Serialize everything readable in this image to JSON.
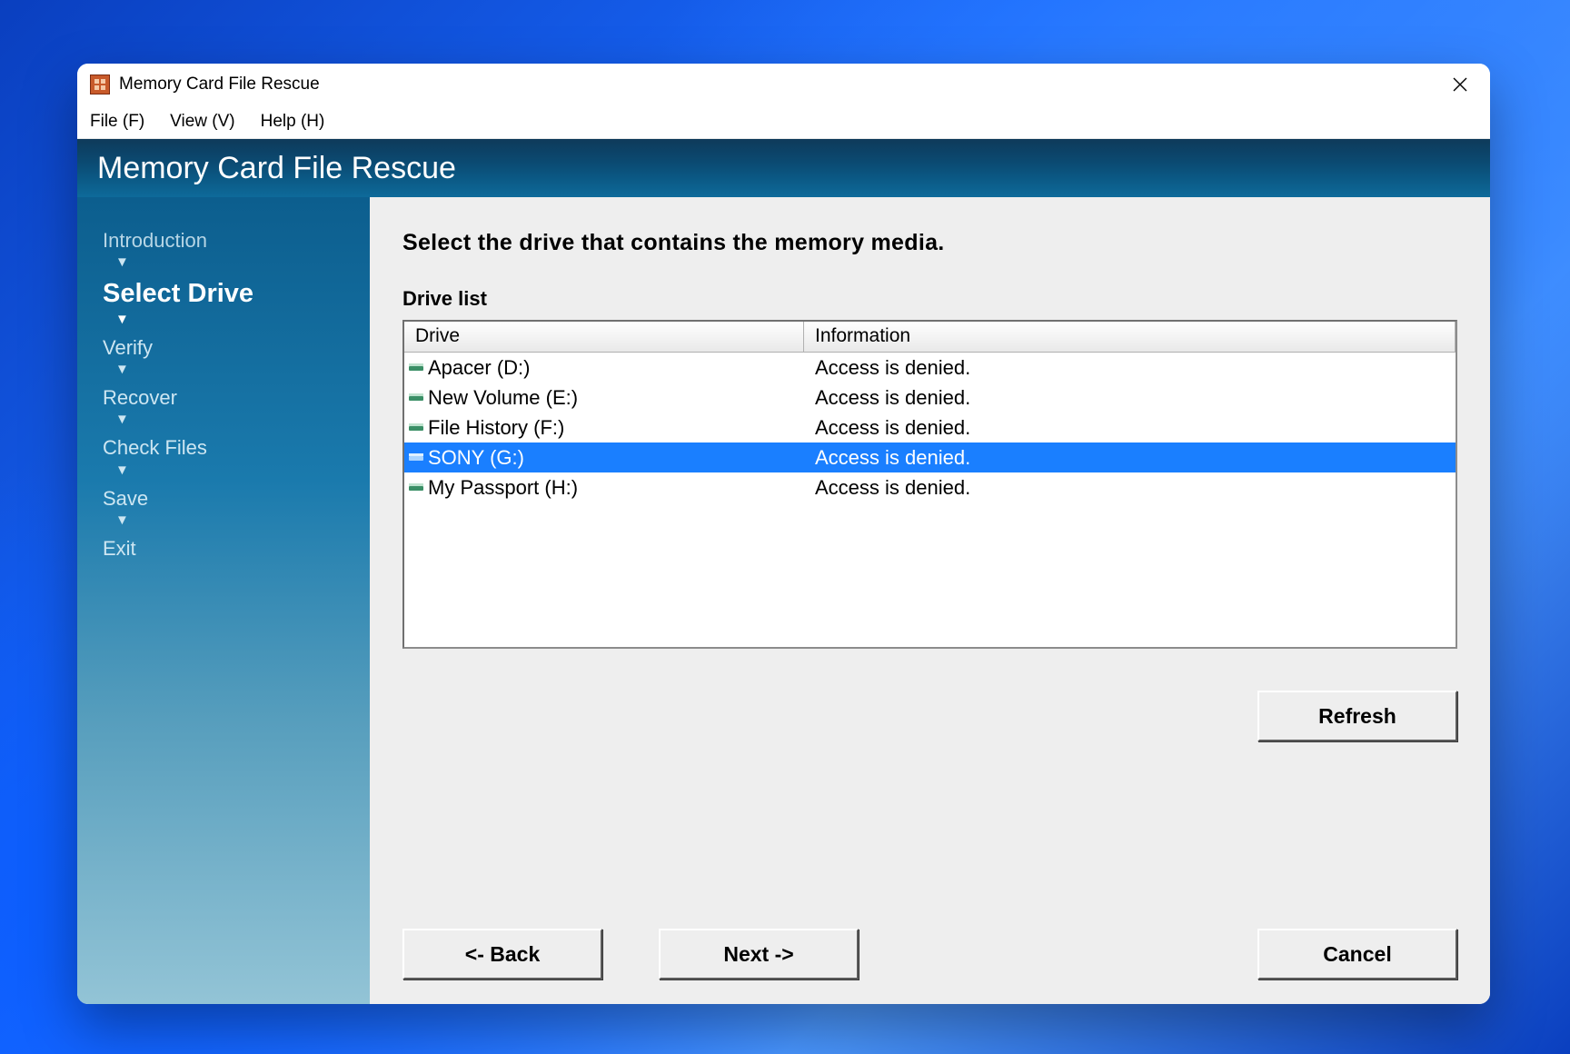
{
  "window": {
    "title": "Memory Card File Rescue"
  },
  "menu": {
    "file": "File (F)",
    "view": "View (V)",
    "help": "Help (H)"
  },
  "banner": {
    "title": "Memory Card File Rescue"
  },
  "steps": {
    "s0": "Introduction",
    "s1": "Select Drive",
    "s2": "Verify",
    "s3": "Recover",
    "s4": "Check Files",
    "s5": "Save",
    "s6": "Exit"
  },
  "main": {
    "heading": "Select the drive that contains the memory media.",
    "list_label": "Drive list",
    "col_drive": "Drive",
    "col_info": "Information"
  },
  "drives": [
    {
      "name": "Apacer (D:)",
      "info": "Access is denied.",
      "selected": false
    },
    {
      "name": "New Volume (E:)",
      "info": "Access is denied.",
      "selected": false
    },
    {
      "name": "File History (F:)",
      "info": "Access is denied.",
      "selected": false
    },
    {
      "name": "SONY (G:)",
      "info": "Access is denied.",
      "selected": true
    },
    {
      "name": "My Passport (H:)",
      "info": "Access is denied.",
      "selected": false
    }
  ],
  "buttons": {
    "refresh": "Refresh",
    "back": "<- Back",
    "next": "Next ->",
    "cancel": "Cancel"
  }
}
